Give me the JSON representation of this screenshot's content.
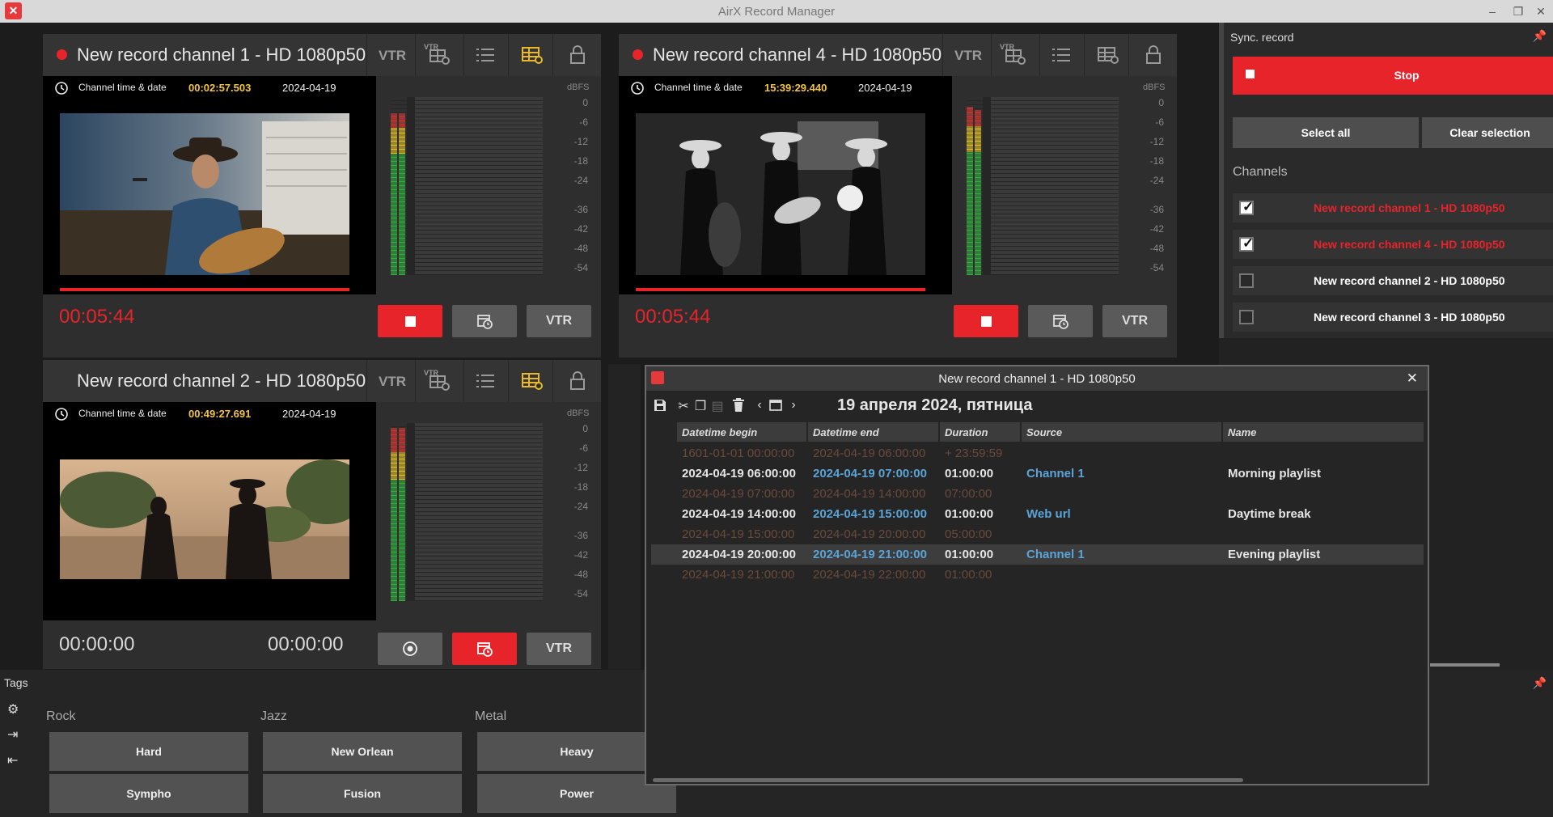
{
  "app": {
    "title": "AirX Record Manager"
  },
  "panels": [
    {
      "title": "New record channel 1 - HD 1080p50",
      "vtr": "VTR",
      "vtr_small": "VTR",
      "channel_time_label": "Channel time & date",
      "channel_time": "00:02:57.503",
      "channel_date": "2024-04-19",
      "dbfs": "dBFS",
      "timer_left": "00:05:44",
      "timer_right": "",
      "vtr_button": "VTR",
      "recording": true
    },
    {
      "title": "New record channel 4 - HD 1080p50",
      "vtr": "VTR",
      "vtr_small": "VTR",
      "channel_time_label": "Channel time & date",
      "channel_time": "15:39:29.440",
      "channel_date": "2024-04-19",
      "dbfs": "dBFS",
      "timer_left": "00:05:44",
      "timer_right": "",
      "vtr_button": "VTR",
      "recording": true
    },
    {
      "title": "New record channel 2 - HD 1080p50",
      "vtr": "VTR",
      "vtr_small": "VTR",
      "channel_time_label": "Channel time & date",
      "channel_time": "00:49:27.691",
      "channel_date": "2024-04-19",
      "dbfs": "dBFS",
      "timer_left": "00:00:00",
      "timer_right": "00:00:00",
      "vtr_button": "VTR",
      "recording": false
    }
  ],
  "db_ticks": [
    "0",
    "-6",
    "-12",
    "-18",
    "-24",
    "-36",
    "-42",
    "-48",
    "-54"
  ],
  "sync": {
    "header": "Sync. record",
    "stop_label": "Stop",
    "select_all": "Select all",
    "clear_selection": "Clear selection",
    "channels_header": "Channels",
    "channels": [
      {
        "name": "New record channel 1 - HD 1080p50",
        "checked": true,
        "recording": true
      },
      {
        "name": "New record channel 4 - HD 1080p50",
        "checked": true,
        "recording": true
      },
      {
        "name": "New record channel 2 - HD 1080p50",
        "checked": false,
        "recording": false
      },
      {
        "name": "New record channel 3 - HD 1080p50",
        "checked": false,
        "recording": false
      }
    ]
  },
  "tags": {
    "header": "Tags",
    "groups": [
      {
        "label": "Rock",
        "items": [
          "Hard",
          "Sympho"
        ]
      },
      {
        "label": "Jazz",
        "items": [
          "New Orlean",
          "Fusion"
        ]
      },
      {
        "label": "Metal",
        "items": [
          "Heavy",
          "Power"
        ]
      }
    ]
  },
  "schedule": {
    "title": "New record channel 1 - HD 1080p50",
    "date_heading": "19 апреля 2024, пятница",
    "columns": [
      "Datetime begin",
      "Datetime end",
      "Duration",
      "Source",
      "Name"
    ],
    "rows": [
      {
        "begin": "1601-01-01 00:00:00",
        "end": "2024-04-19 06:00:00",
        "duration": "+ 23:59:59",
        "source": "",
        "name": "",
        "gap": true
      },
      {
        "begin": "2024-04-19 06:00:00",
        "end": "2024-04-19 07:00:00",
        "duration": "01:00:00",
        "source": "Channel 1",
        "name": "Morning playlist",
        "gap": false
      },
      {
        "begin": "2024-04-19 07:00:00",
        "end": "2024-04-19 14:00:00",
        "duration": "07:00:00",
        "source": "",
        "name": "",
        "gap": true
      },
      {
        "begin": "2024-04-19 14:00:00",
        "end": "2024-04-19 15:00:00",
        "duration": "01:00:00",
        "source": "Web url",
        "name": "Daytime break",
        "gap": false
      },
      {
        "begin": "2024-04-19 15:00:00",
        "end": "2024-04-19 20:00:00",
        "duration": "05:00:00",
        "source": "",
        "name": "",
        "gap": true
      },
      {
        "begin": "2024-04-19 20:00:00",
        "end": "2024-04-19 21:00:00",
        "duration": "01:00:00",
        "source": "Channel 1",
        "name": "Evening playlist",
        "gap": false,
        "selected": true
      },
      {
        "begin": "2024-04-19 21:00:00",
        "end": "2024-04-19 22:00:00",
        "duration": "01:00:00",
        "source": "",
        "name": "",
        "gap": true
      }
    ]
  },
  "colors": {
    "accent_red": "#e8242b",
    "time_yellow": "#f5c542",
    "link_blue": "#5aa4d8"
  }
}
